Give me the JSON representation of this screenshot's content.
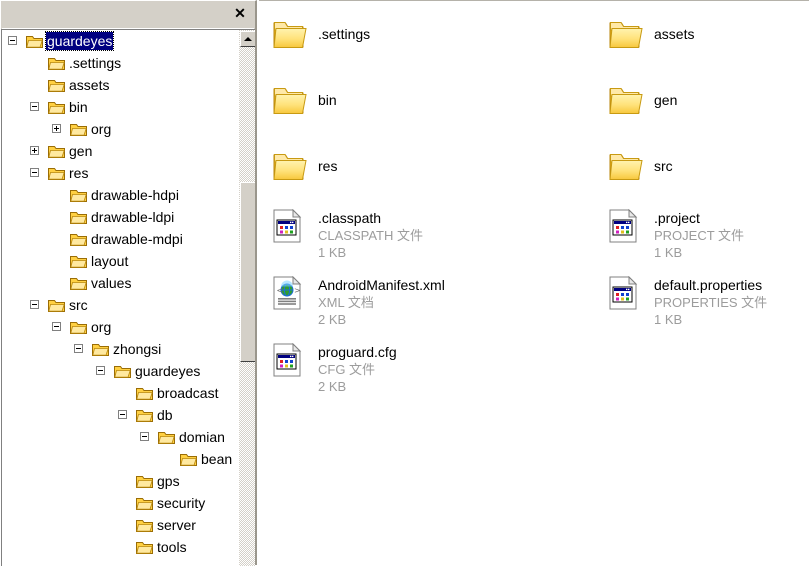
{
  "window": {
    "title": "",
    "close_label": "✕"
  },
  "tree": {
    "scrollbar": {
      "up_arrow": "▲",
      "down_arrow": "▼"
    },
    "nodes": [
      {
        "label": "guardeyes",
        "depth": 0,
        "expander": "minus",
        "selected": true
      },
      {
        "label": ".settings",
        "depth": 1,
        "expander": "none",
        "selected": false
      },
      {
        "label": "assets",
        "depth": 1,
        "expander": "none",
        "selected": false
      },
      {
        "label": "bin",
        "depth": 1,
        "expander": "minus",
        "selected": false
      },
      {
        "label": "org",
        "depth": 2,
        "expander": "plus",
        "selected": false
      },
      {
        "label": "gen",
        "depth": 1,
        "expander": "plus",
        "selected": false
      },
      {
        "label": "res",
        "depth": 1,
        "expander": "minus",
        "selected": false
      },
      {
        "label": "drawable-hdpi",
        "depth": 2,
        "expander": "none",
        "selected": false
      },
      {
        "label": "drawable-ldpi",
        "depth": 2,
        "expander": "none",
        "selected": false
      },
      {
        "label": "drawable-mdpi",
        "depth": 2,
        "expander": "none",
        "selected": false
      },
      {
        "label": "layout",
        "depth": 2,
        "expander": "none",
        "selected": false
      },
      {
        "label": "values",
        "depth": 2,
        "expander": "none",
        "selected": false
      },
      {
        "label": "src",
        "depth": 1,
        "expander": "minus",
        "selected": false
      },
      {
        "label": "org",
        "depth": 2,
        "expander": "minus",
        "selected": false
      },
      {
        "label": "zhongsi",
        "depth": 3,
        "expander": "minus",
        "selected": false
      },
      {
        "label": "guardeyes",
        "depth": 4,
        "expander": "minus",
        "selected": false
      },
      {
        "label": "broadcast",
        "depth": 5,
        "expander": "none",
        "selected": false
      },
      {
        "label": "db",
        "depth": 5,
        "expander": "minus",
        "selected": false
      },
      {
        "label": "domian",
        "depth": 6,
        "expander": "minus",
        "selected": false
      },
      {
        "label": "bean",
        "depth": 7,
        "expander": "none",
        "selected": false
      },
      {
        "label": "gps",
        "depth": 5,
        "expander": "none",
        "selected": false
      },
      {
        "label": "security",
        "depth": 5,
        "expander": "none",
        "selected": false
      },
      {
        "label": "server",
        "depth": 5,
        "expander": "none",
        "selected": false
      },
      {
        "label": "tools",
        "depth": 5,
        "expander": "none",
        "selected": false
      }
    ]
  },
  "files": {
    "items": [
      {
        "name": ".settings",
        "kind": "folder",
        "icon": "folder-icon",
        "type": "",
        "size": "",
        "col": 0,
        "row": 0
      },
      {
        "name": "assets",
        "kind": "folder",
        "icon": "folder-icon",
        "type": "",
        "size": "",
        "col": 1,
        "row": 0
      },
      {
        "name": "bin",
        "kind": "folder",
        "icon": "folder-icon",
        "type": "",
        "size": "",
        "col": 0,
        "row": 1
      },
      {
        "name": "gen",
        "kind": "folder",
        "icon": "folder-icon",
        "type": "",
        "size": "",
        "col": 1,
        "row": 1
      },
      {
        "name": "res",
        "kind": "folder",
        "icon": "folder-icon",
        "type": "",
        "size": "",
        "col": 0,
        "row": 2
      },
      {
        "name": "src",
        "kind": "folder",
        "icon": "folder-icon",
        "type": "",
        "size": "",
        "col": 1,
        "row": 2
      },
      {
        "name": ".classpath",
        "kind": "file",
        "icon": "generic-file-icon",
        "type": "CLASSPATH 文件",
        "size": "1 KB",
        "col": 0,
        "row": 3
      },
      {
        "name": ".project",
        "kind": "file",
        "icon": "generic-file-icon",
        "type": "PROJECT 文件",
        "size": "1 KB",
        "col": 1,
        "row": 3
      },
      {
        "name": "AndroidManifest.xml",
        "kind": "file",
        "icon": "xml-file-icon",
        "type": "XML 文档",
        "size": "2 KB",
        "col": 0,
        "row": 4
      },
      {
        "name": "default.properties",
        "kind": "file",
        "icon": "generic-file-icon",
        "type": "PROPERTIES 文件",
        "size": "1 KB",
        "col": 1,
        "row": 4
      },
      {
        "name": "proguard.cfg",
        "kind": "file",
        "icon": "generic-file-icon",
        "type": "CFG 文件",
        "size": "2 KB",
        "col": 0,
        "row": 5
      }
    ]
  },
  "colors": {
    "selection": "#000080",
    "chrome": "#d4d0c8",
    "folder_body": "#ffd966",
    "folder_edge": "#c08a1e",
    "muted_text": "#9c9c9c"
  }
}
